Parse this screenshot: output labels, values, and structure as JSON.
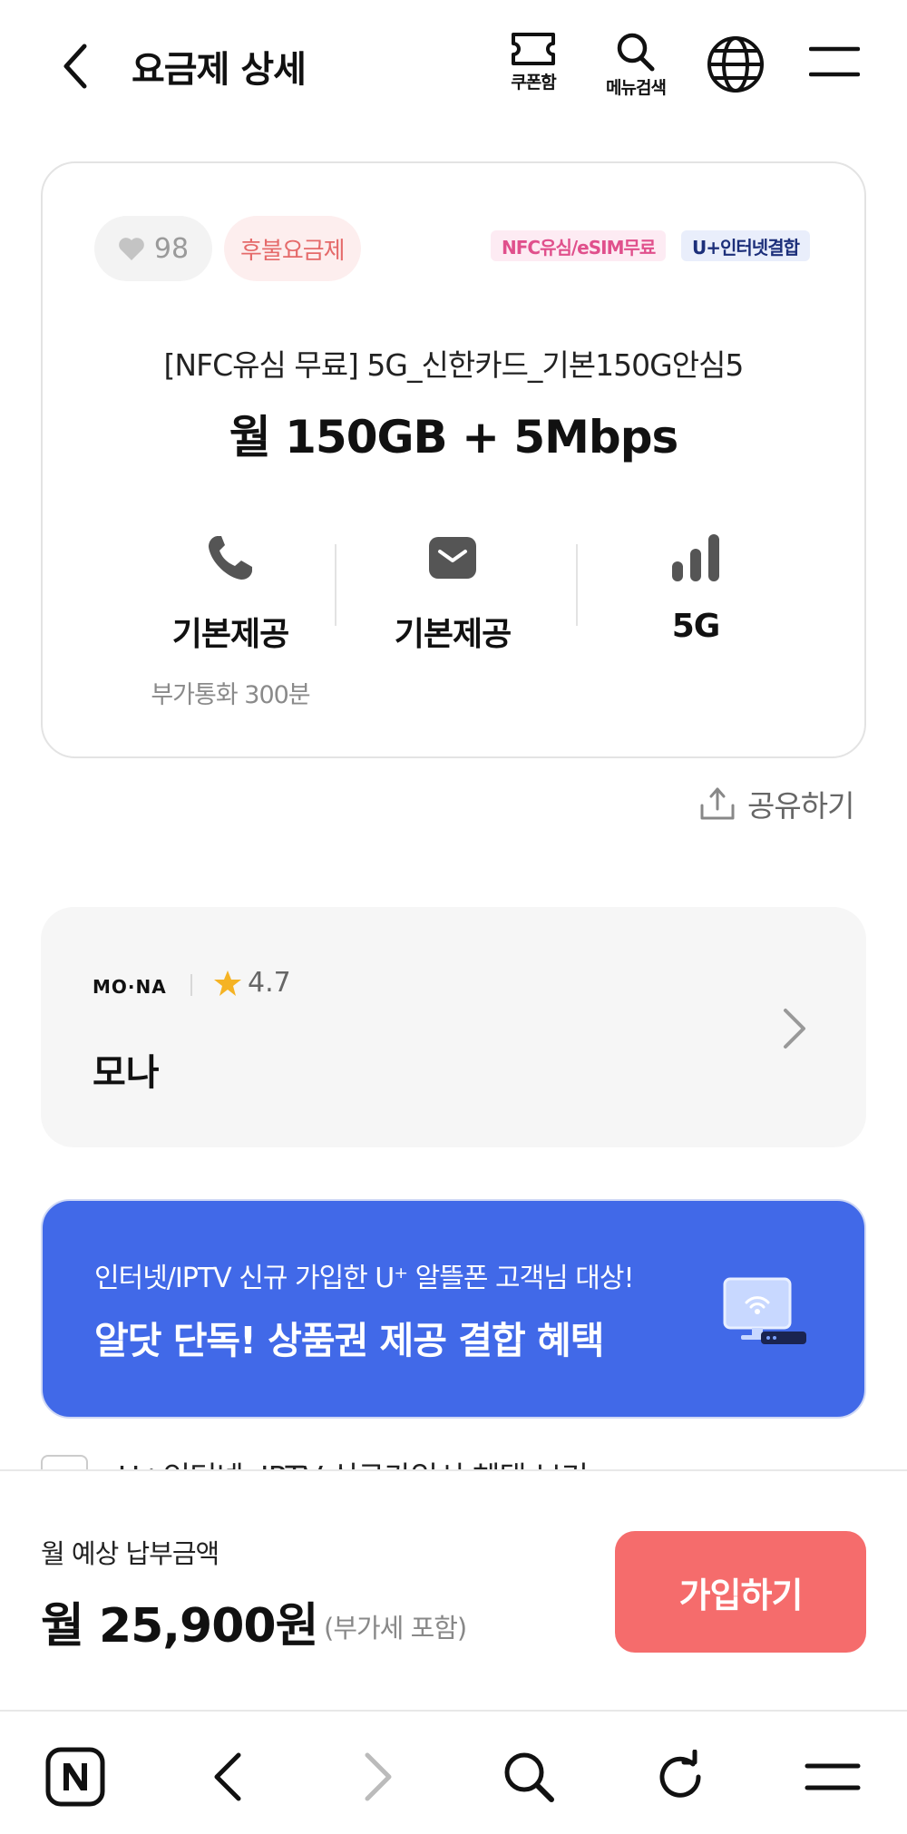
{
  "header": {
    "title": "요금제 상세",
    "coupon_label": "쿠폰함",
    "menu_search_label": "메뉴검색"
  },
  "plan": {
    "likes": "98",
    "badge": "후불요금제",
    "tags": [
      "NFC유심/eSIM무료",
      "U+인터넷결합"
    ],
    "name": "[NFC유심 무료] 5G_신한카드_기본150G안심5",
    "data": "월 150GB + 5Mbps",
    "features": [
      {
        "icon": "phone-icon",
        "value": "기본제공",
        "sub": "부가통화 300분"
      },
      {
        "icon": "message-icon",
        "value": "기본제공",
        "sub": ""
      },
      {
        "icon": "signal-icon",
        "value": "5G",
        "sub": ""
      }
    ]
  },
  "share_label": "공유하기",
  "mvno": {
    "logo": "MO·NA",
    "rating": "4.7",
    "name": "모나"
  },
  "banner": {
    "line1": "인터넷/IPTV 신규 가입한 U⁺ 알뜰폰 고객님 대상!",
    "line2": "알닷 단독! 상품권 제공 결합 혜택"
  },
  "peek_text": "U+인터넷, IPTV 신규가입시 혜택 보기",
  "bottom": {
    "label": "월 예상 납부금액",
    "price": "월 25,900원",
    "vat": "(부가세 포함)",
    "join": "가입하기"
  },
  "colors": {
    "accent": "#f56c6c",
    "banner": "#4169e8",
    "tag_nfc": "#e0508c",
    "tag_uplus": "#1c2f7a"
  }
}
